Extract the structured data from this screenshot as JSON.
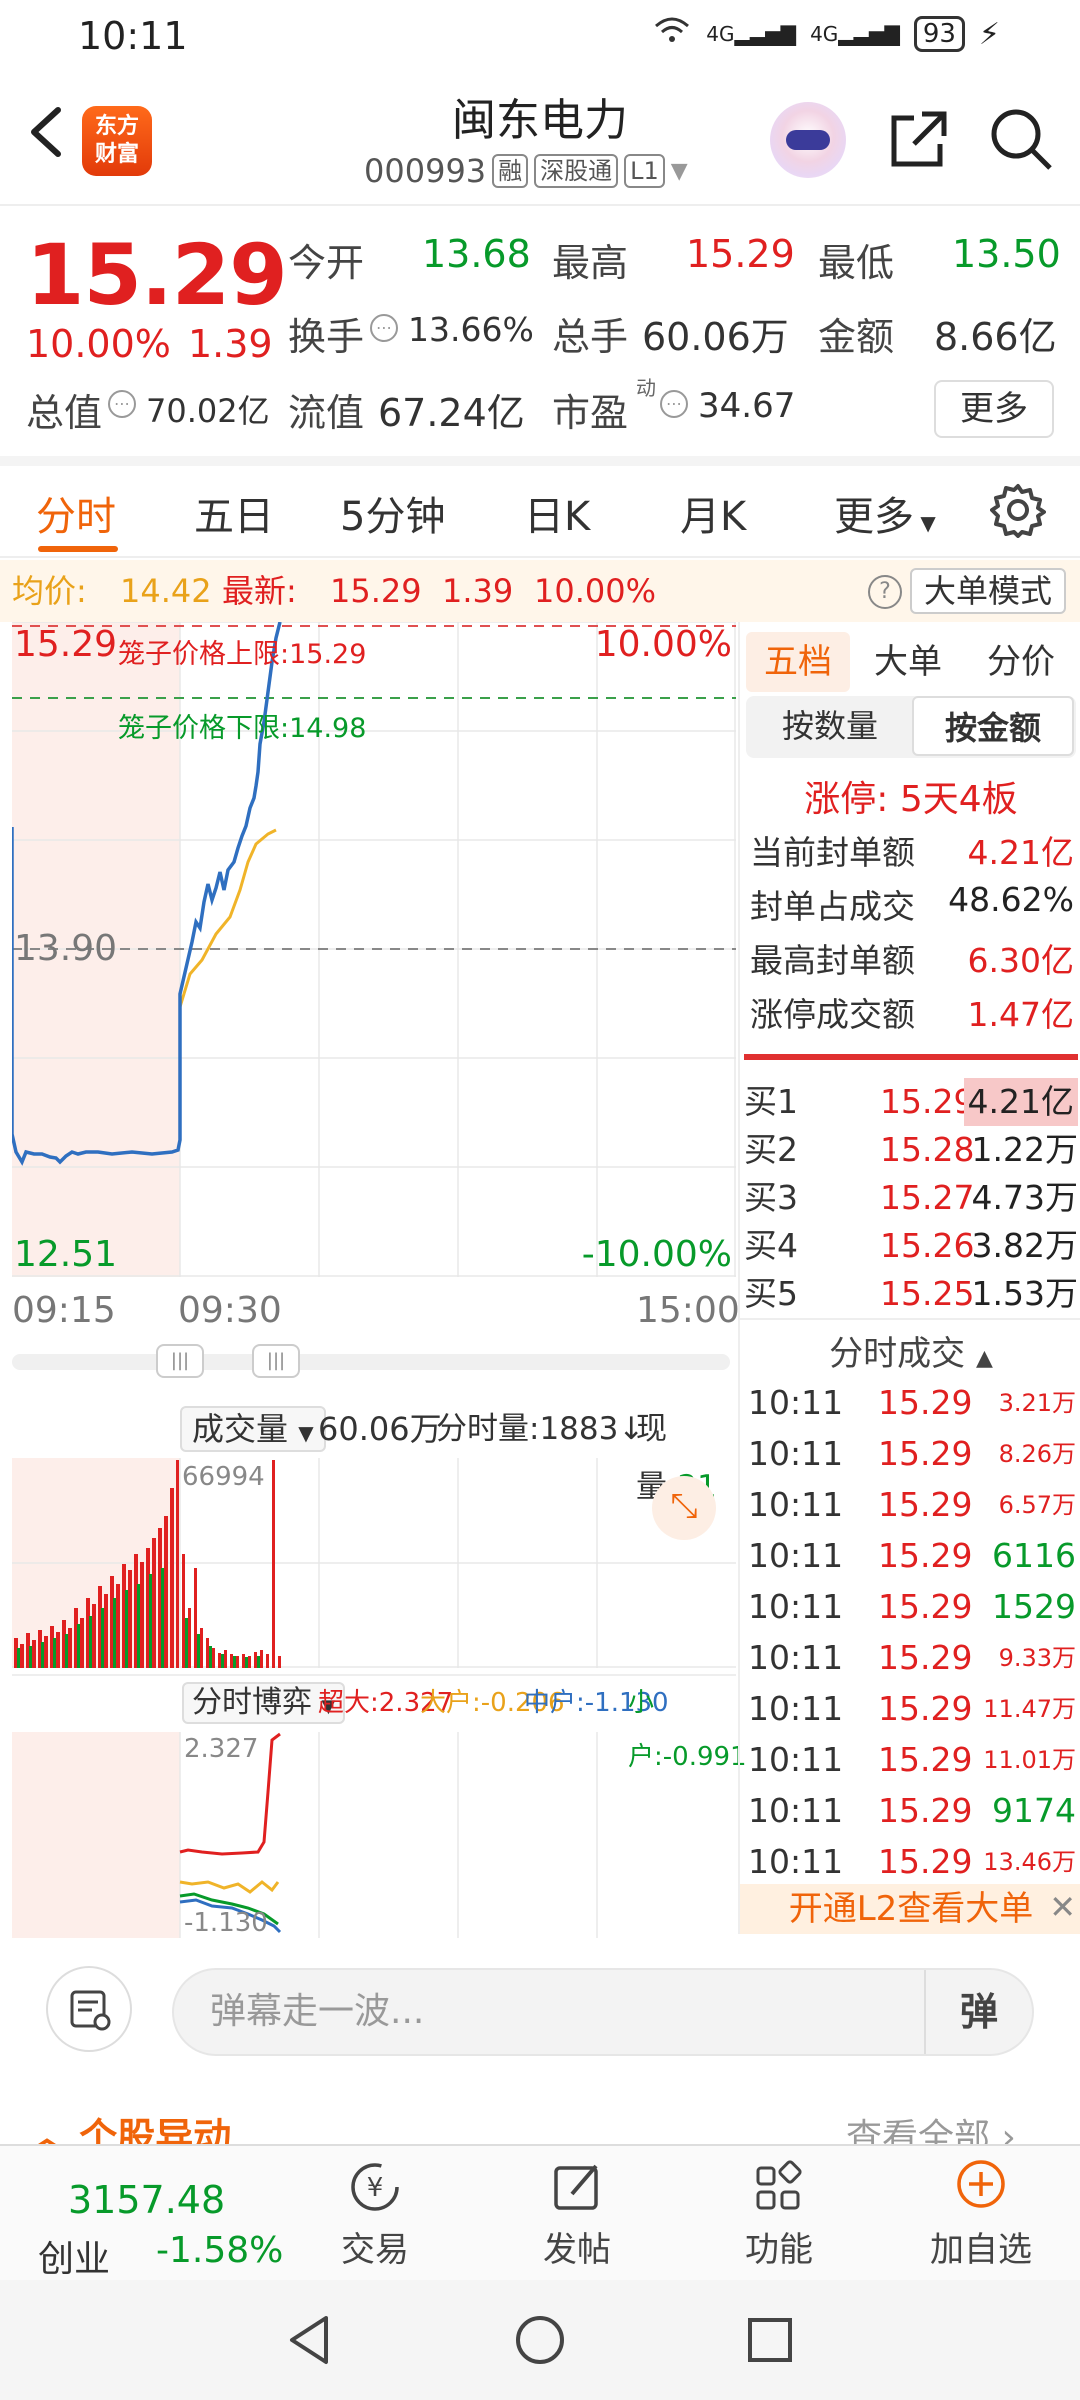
{
  "status": {
    "time": "10:11",
    "net1": "4G",
    "net2": "4G",
    "battery": "93"
  },
  "header": {
    "logo_line1": "东方",
    "logo_line2": "财富",
    "name": "闽东电力",
    "code": "000993",
    "tags": [
      "融",
      "深股通",
      "L1"
    ]
  },
  "quote": {
    "price": "15.29",
    "pct": "10.00%",
    "change": "1.39",
    "rows": [
      {
        "label": "今开",
        "value": "13.68",
        "color": "green"
      },
      {
        "label": "最高",
        "value": "15.29",
        "color": "red"
      },
      {
        "label": "最低",
        "value": "13.50",
        "color": "green"
      },
      {
        "label": "换手",
        "value": "13.66%",
        "color": "gray"
      },
      {
        "label": "总手",
        "value": "60.06万",
        "color": "gray"
      },
      {
        "label": "金额",
        "value": "8.66亿",
        "color": "gray"
      },
      {
        "label": "总值",
        "value": "70.02亿",
        "color": "gray"
      },
      {
        "label": "流值",
        "value": "67.24亿",
        "color": "gray"
      },
      {
        "label": "市盈",
        "value": "34.67",
        "color": "gray"
      }
    ],
    "pe_superscript": "动",
    "more": "更多"
  },
  "tabs": [
    "分时",
    "五日",
    "5分钟",
    "日K",
    "月K",
    "更多"
  ],
  "infoline": {
    "avg_label": "均价:",
    "avg_value": "14.42",
    "latest_label": "最新:",
    "latest_value": "15.29",
    "latest_change": "1.39",
    "latest_pct": "10.00%",
    "help": "?",
    "big_mode": "大单模式"
  },
  "chart_main": {
    "top_price": "15.29",
    "top_pct": "10.00%",
    "mid_price": "13.90",
    "bottom_price": "12.51",
    "bottom_pct": "-10.00%",
    "upper_cage_label": "笼子价格上限:",
    "upper_cage_value": "15.29",
    "lower_cage_label": "笼子价格下限:",
    "lower_cage_value": "14.98",
    "times": [
      "09:15",
      "09:30",
      "15:00"
    ]
  },
  "volume": {
    "dropdown": "成交量",
    "total": "60.06万",
    "fs_label": "分时量:1883↓",
    "now_label": "现量:",
    "now_value": "21",
    "peak": "66994"
  },
  "game": {
    "dropdown": "分时博弈",
    "super_label": "超大:",
    "super_value": "2.327",
    "big_label": "大户:",
    "big_value": "-0.206",
    "mid_label": "中户:",
    "mid_value": "-1.130",
    "small_label": "小户:",
    "small_value": "-0.991",
    "top": "2.327",
    "bottom": "-1.130"
  },
  "panel": {
    "tabs": [
      "五档",
      "大单",
      "分价"
    ],
    "seg": [
      "按数量",
      "按金额"
    ],
    "limit_title": "涨停: 5天4板",
    "limit_rows": [
      {
        "label": "当前封单额",
        "value": "4.21亿",
        "color": "red"
      },
      {
        "label": "封单占成交",
        "value": "48.62%",
        "color": "dark"
      },
      {
        "label": "最高封单额",
        "value": "6.30亿",
        "color": "red"
      },
      {
        "label": "涨停成交额",
        "value": "1.47亿",
        "color": "red"
      }
    ],
    "bids": [
      {
        "name": "买1",
        "price": "15.29",
        "qty": "4.21亿"
      },
      {
        "name": "买2",
        "price": "15.28",
        "qty": "1.22万"
      },
      {
        "name": "买3",
        "price": "15.27",
        "qty": "4.73万"
      },
      {
        "name": "买4",
        "price": "15.26",
        "qty": "3.82万"
      },
      {
        "name": "买5",
        "price": "15.25",
        "qty": "1.53万"
      }
    ],
    "ticks_title": "分时成交",
    "ticks": [
      {
        "time": "10:11",
        "price": "15.29",
        "vol": "3.21万",
        "color": "red"
      },
      {
        "time": "10:11",
        "price": "15.29",
        "vol": "8.26万",
        "color": "red"
      },
      {
        "time": "10:11",
        "price": "15.29",
        "vol": "6.57万",
        "color": "red"
      },
      {
        "time": "10:11",
        "price": "15.29",
        "vol": "6116",
        "color": "green"
      },
      {
        "time": "10:11",
        "price": "15.29",
        "vol": "1529",
        "color": "green"
      },
      {
        "time": "10:11",
        "price": "15.29",
        "vol": "9.33万",
        "color": "red"
      },
      {
        "time": "10:11",
        "price": "15.29",
        "vol": "11.47万",
        "color": "red"
      },
      {
        "time": "10:11",
        "price": "15.29",
        "vol": "11.01万",
        "color": "red"
      },
      {
        "time": "10:11",
        "price": "15.29",
        "vol": "9174",
        "color": "green"
      },
      {
        "time": "10:11",
        "price": "15.29",
        "vol": "13.46万",
        "color": "red"
      }
    ],
    "l2": "开通L2查看大单",
    "l2_close": "✕"
  },
  "comment": {
    "placeholder": "弹幕走一波...",
    "dan": "弹"
  },
  "newspeek": {
    "left": "个股异动",
    "right": "查看全部"
  },
  "bottombar": {
    "index_value": "3157.48",
    "index_name": "创业",
    "index_change": "-1.58%",
    "items": [
      "交易",
      "发帖",
      "功能",
      "加自选"
    ]
  },
  "colors": {
    "up": "#e02020",
    "down": "#079a2a",
    "accent": "#f0640a",
    "price_line": "#2f6fc0",
    "avg_line": "#f0b429"
  }
}
